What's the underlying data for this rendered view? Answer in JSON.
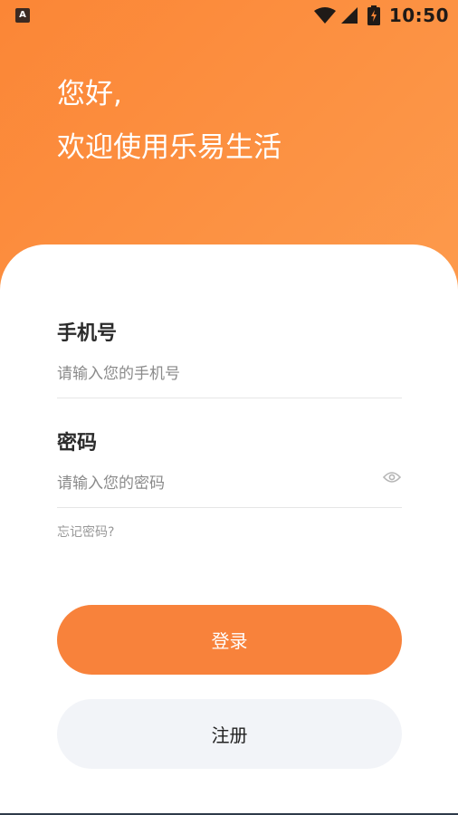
{
  "status_bar": {
    "app_icon_letter": "A",
    "time": "10:50",
    "icons": [
      "wifi-icon",
      "signal-icon",
      "battery-charging-icon"
    ]
  },
  "header": {
    "greeting_line1": "您好,",
    "greeting_line2": "欢迎使用乐易生活"
  },
  "form": {
    "phone": {
      "label": "手机号",
      "placeholder": "请输入您的手机号",
      "value": ""
    },
    "password": {
      "label": "密码",
      "placeholder": "请输入您的密码",
      "value": "",
      "toggle_icon": "eye-icon"
    },
    "forgot_password": "忘记密码?"
  },
  "actions": {
    "login_label": "登录",
    "register_label": "注册"
  },
  "colors": {
    "accent": "#f8823b",
    "gradient_start": "#fb8636",
    "gradient_end": "#fd9a4c",
    "register_bg": "#f2f4f8"
  }
}
